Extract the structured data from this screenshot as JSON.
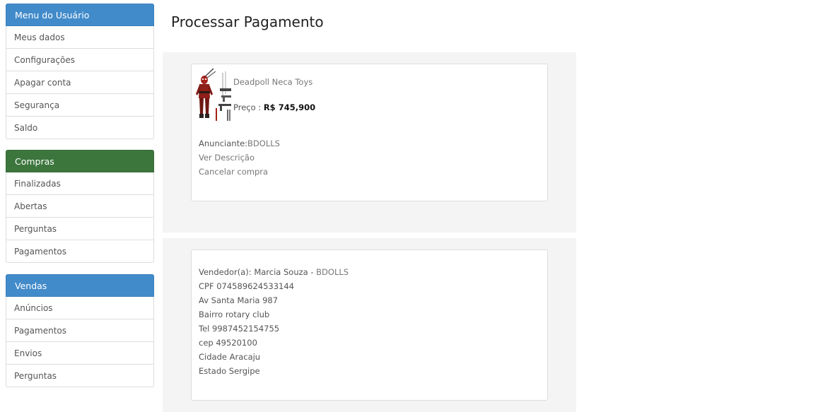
{
  "sidebar": {
    "user_menu": {
      "title": "Menu do Usuário",
      "items": [
        "Meus dados",
        "Configurações",
        "Apagar conta",
        "Segurança",
        "Saldo"
      ]
    },
    "purchases_menu": {
      "title": "Compras",
      "items": [
        "Finalizadas",
        "Abertas",
        "Perguntas",
        "Pagamentos"
      ]
    },
    "sales_menu": {
      "title": "Vendas",
      "items": [
        "Anúncios",
        "Pagamentos",
        "Envios",
        "Perguntas"
      ]
    }
  },
  "page_title": "Processar Pagamento",
  "product": {
    "name": "Deadpoll Neca Toys",
    "price_label": "Preço : ",
    "price_value": "R$ 745,900",
    "advertiser_label": "Anunciante:",
    "advertiser_value": "BDOLLS",
    "view_description": "Ver Descrição",
    "cancel_purchase": "Cancelar compra"
  },
  "seller": {
    "seller_label": "Vendedor(a): Marcia Souza - ",
    "seller_store": "BDOLLS",
    "cpf": "CPF 074589624533144",
    "address": "Av Santa Maria 987",
    "neighborhood": "Bairro rotary club",
    "phone": "Tel 9987452154755",
    "zip": "cep 49520100",
    "city": "Cidade Aracaju",
    "state": "Estado Sergipe"
  },
  "colors": {
    "menu_blue": "#428bca",
    "menu_green": "#3c763d",
    "well_bg": "#f4f4f4"
  }
}
